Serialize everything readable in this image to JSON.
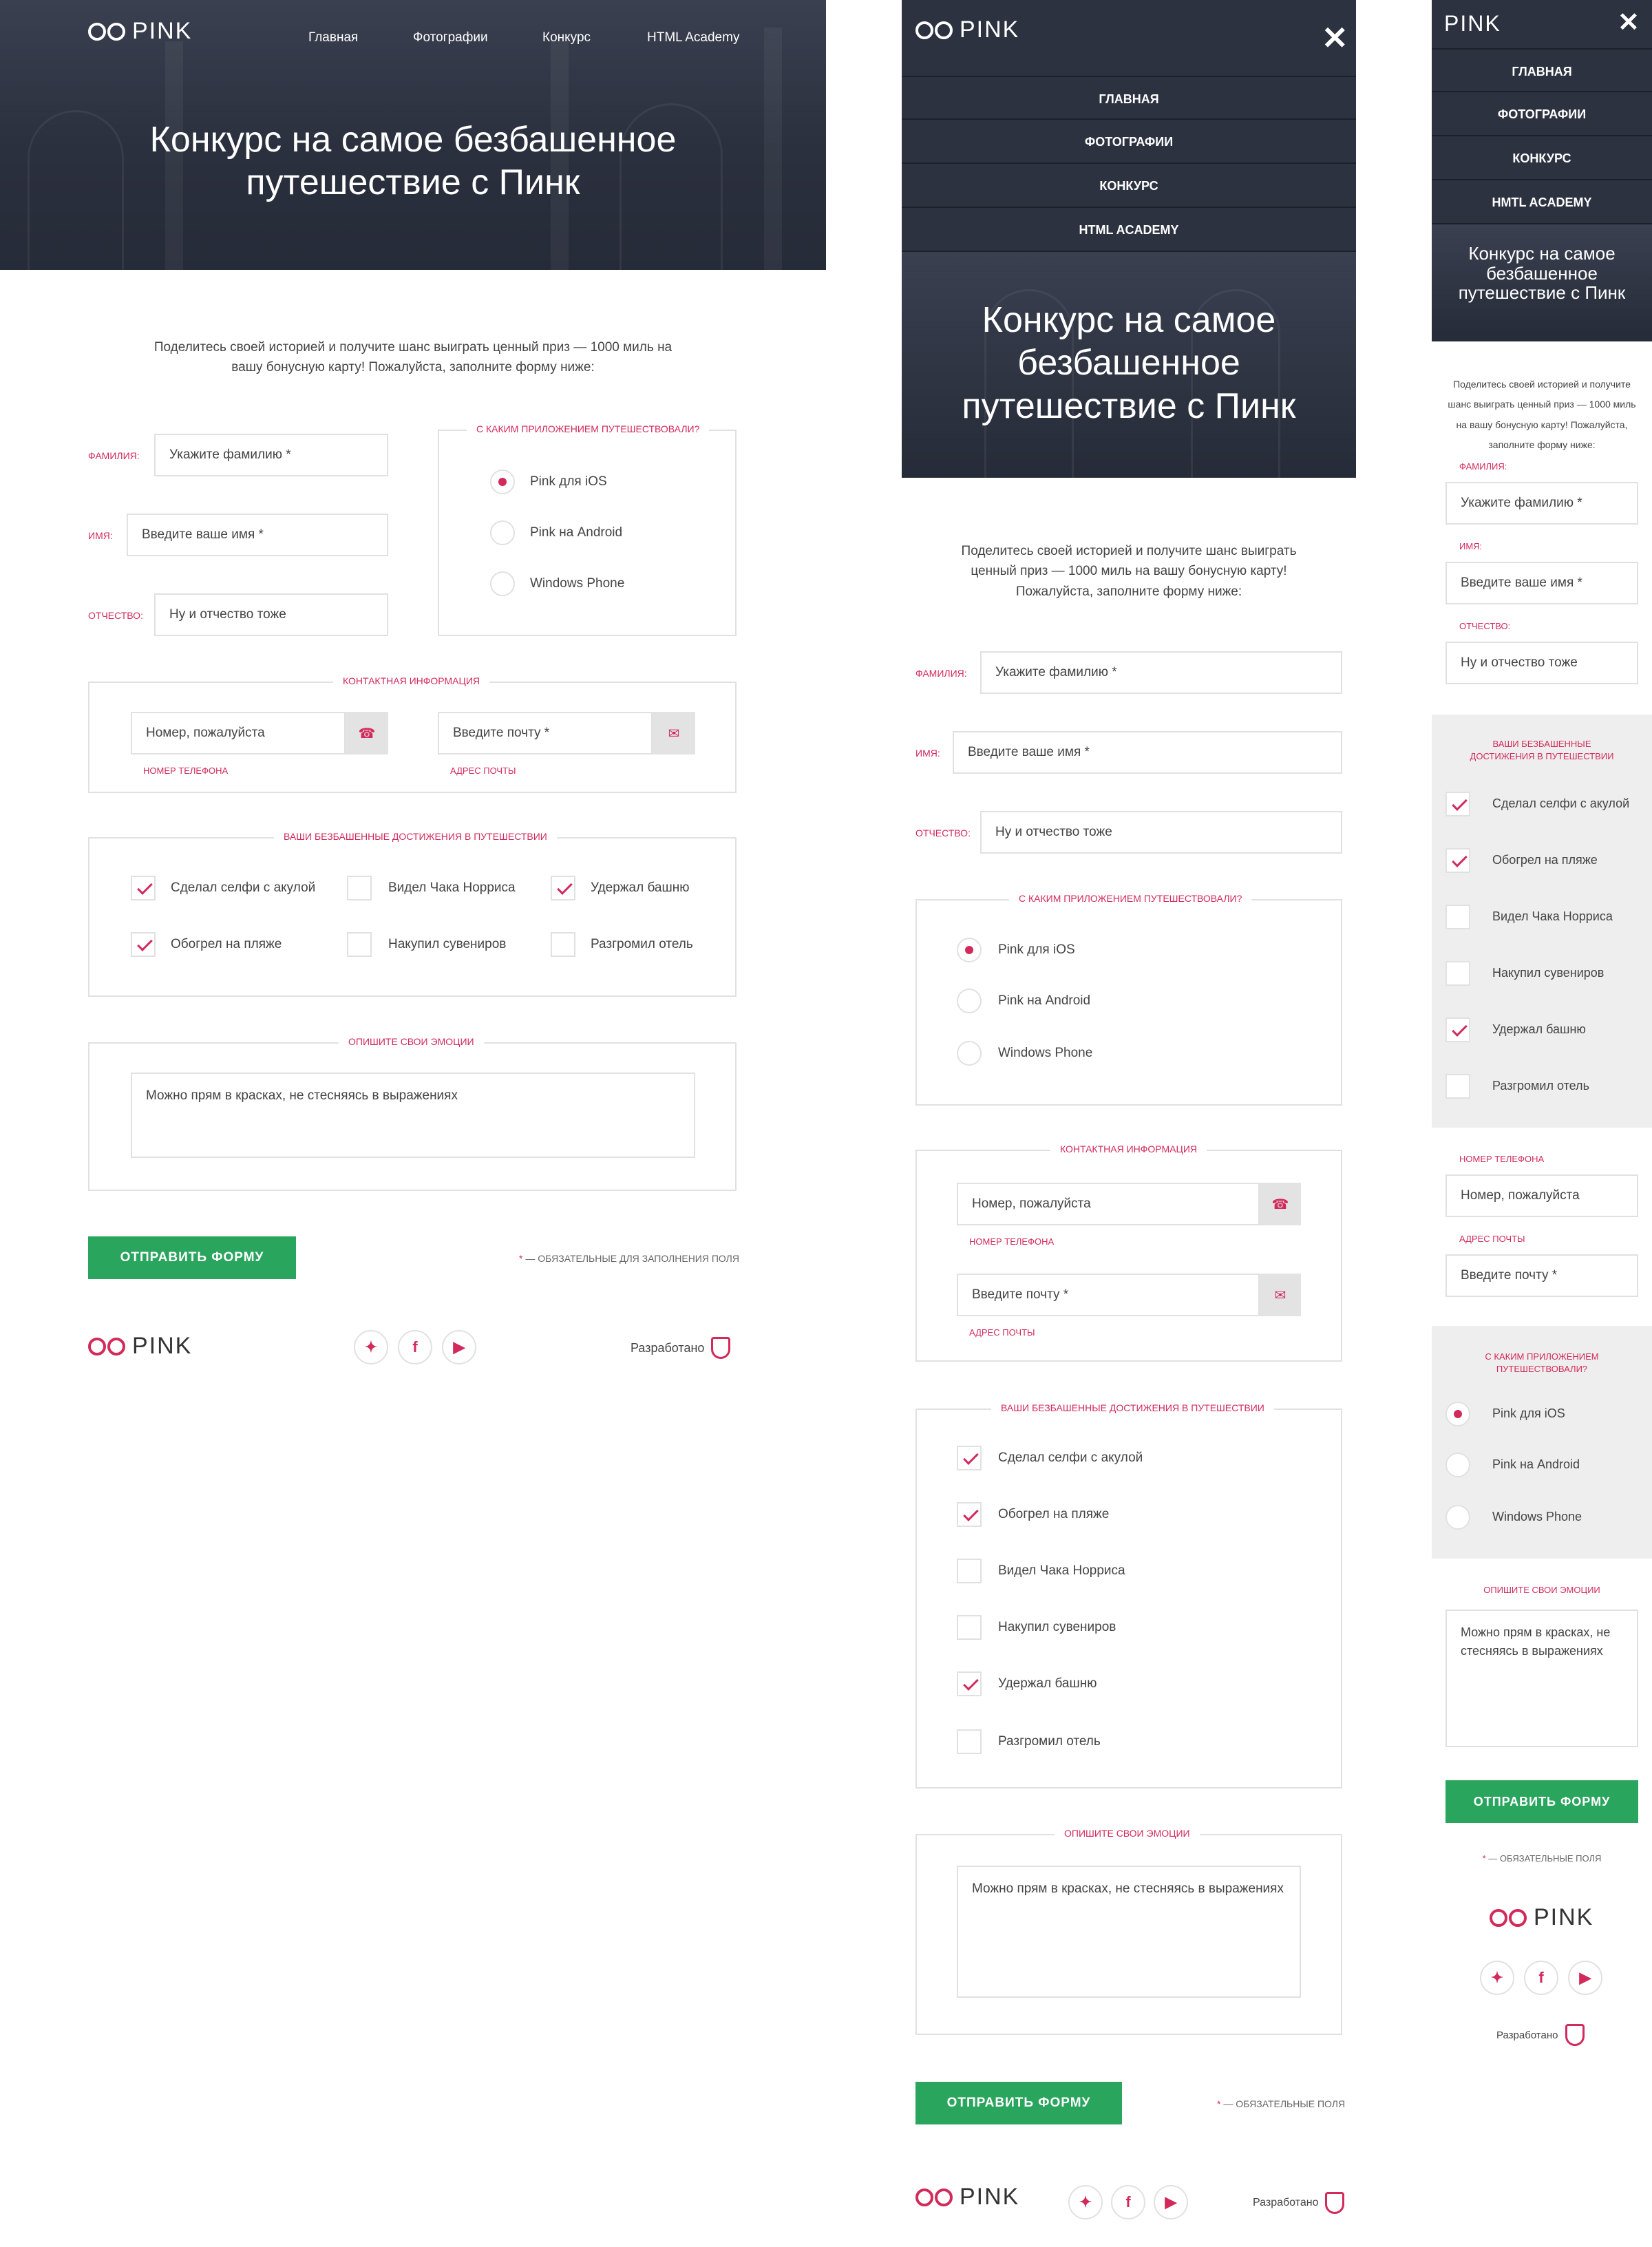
{
  "brand": {
    "logo_text": "PINK",
    "accent_color": "#d22a5b",
    "button_color": "#2aa55e",
    "header_bg": "#2d3241"
  },
  "nav": [
    "Главная",
    "Фотографии",
    "Конкурс",
    "HTML Academy"
  ],
  "tablet_menu": [
    "ГЛАВНАЯ",
    "ФОТОГРАФИИ",
    "КОНКУРС",
    "HTML ACADEMY"
  ],
  "mobile_menu": [
    "ГЛАВНАЯ",
    "ФОТОГРАФИИ",
    "КОНКУРС",
    "HMTL ACADEMY"
  ],
  "hero_title": "Конкурс на самое безбашенное путешествие с Пинк",
  "intro": "Поделитесь своей историей и получите шанс выиграть ценный приз — 1000 миль на вашу бонусную карту! Пожалуйста, заполните форму ниже:",
  "fields": {
    "surname_label": "Фамилия:",
    "surname_placeholder": "Укажите фамилию *",
    "name_label": "Имя:",
    "name_placeholder": "Введите ваше имя *",
    "patronymic_label": "Отчество:",
    "patronymic_placeholder": "Ну и отчество тоже"
  },
  "app": {
    "legend": "С каким приложением путешествовали?",
    "options": [
      "Pink для iOS",
      "Pink на Android",
      "Windows Phone"
    ],
    "selected": "Pink для iOS"
  },
  "contacts": {
    "legend": "Контактная информация",
    "phone_placeholder": "Номер, пожалуйста",
    "phone_label": "Номер телефона",
    "email_placeholder": "Введите почту *",
    "email_label": "Адрес почты"
  },
  "achievements": {
    "legend": "Ваши безбашенные достижения в путешествии",
    "items": [
      {
        "label": "Сделал селфи с акулой",
        "checked": true
      },
      {
        "label": "Обогрел на пляже",
        "checked": true
      },
      {
        "label": "Видел Чака Норриса",
        "checked": false
      },
      {
        "label": "Накупил сувениров",
        "checked": false
      },
      {
        "label": "Удержал башню",
        "checked": true
      },
      {
        "label": "Разгромил отель",
        "checked": false
      }
    ]
  },
  "emotions": {
    "legend": "Опишите свои эмоции",
    "text": "Можно прям в красках, не стесняясь в выражениях"
  },
  "submit_label": "Отправить форму",
  "required_note": "— обязательные для заполнения поля",
  "required_note_short": "— обязательные поля",
  "required_star": "*",
  "footer": {
    "developed": "Разработано",
    "social": [
      "twitter-icon",
      "facebook-icon",
      "youtube-icon"
    ],
    "social_glyphs": [
      "✦",
      "f",
      "▶"
    ]
  }
}
